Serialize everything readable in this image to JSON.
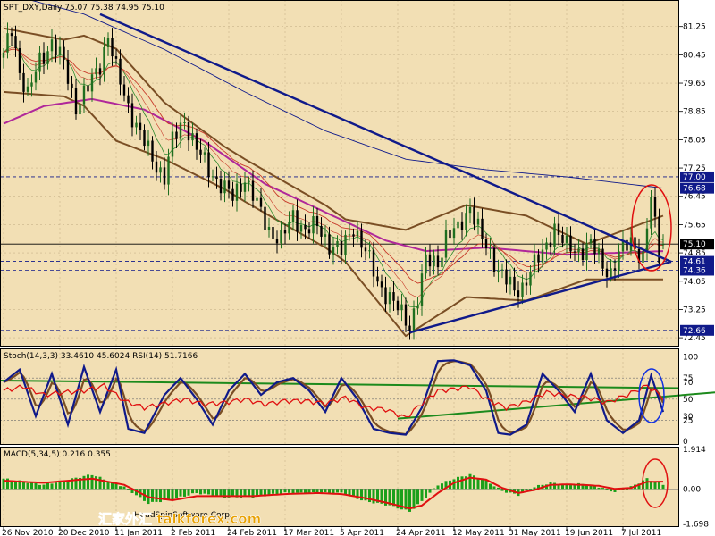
{
  "colors": {
    "panel_bg": "#f2dfb4",
    "frame": "#000000",
    "grid": "#c8b48a",
    "bull": "#1f6e1f",
    "bear": "#000000",
    "bollinger": "#7a4e24",
    "ma_pink": "#b0279a",
    "ma_red": "#c83a2a",
    "ma_green": "#2e8b2e",
    "navy": "#101a8a",
    "stoch_main": "#101a8a",
    "stoch_signal": "#7a4e24",
    "rsi": "#e01010",
    "trend_green": "#1c8a1c",
    "macd_hist": "#1aa01a",
    "macd_signal": "#e01010",
    "circle_red": "#e01010",
    "circle_blue": "#1030e0",
    "level_box": "#101a8a",
    "level_box_price": "#000000"
  },
  "header": {
    "main": "SPT_DXY,Daily  75.07 75.38 74.95 75.10",
    "stoch": "Stoch(14,3,3) 33.4610 45.6024  RSI(14) 51.7166",
    "macd": "MACD(5,34,5) 0.216 0.355",
    "copyright": "HeadSpinSoftware Corp.",
    "watermark": "汇家外汇 talkforex.com"
  },
  "price_axis": {
    "ticks": [
      "81.25",
      "80.45",
      "79.65",
      "78.85",
      "78.05",
      "77.25",
      "76.45",
      "75.65",
      "74.85",
      "74.05",
      "73.25",
      "72.45"
    ],
    "boxes": [
      {
        "label": "77.00",
        "price": 77.0,
        "style": "level"
      },
      {
        "label": "76.68",
        "price": 76.68,
        "style": "level"
      },
      {
        "label": "75.10",
        "price": 75.1,
        "style": "price"
      },
      {
        "label": "74.61",
        "price": 74.61,
        "style": "level"
      },
      {
        "label": "74.36",
        "price": 74.36,
        "style": "level"
      },
      {
        "label": "72.66",
        "price": 72.66,
        "style": "level"
      }
    ]
  },
  "stoch_axis": {
    "ticks": [
      "100",
      "75",
      "70",
      "50",
      "30",
      "25",
      "0"
    ]
  },
  "macd_axis": {
    "ticks": [
      "1.914",
      "0.00",
      "-1.698"
    ]
  },
  "x_axis": {
    "labels": [
      "26 Nov 2010",
      "20 Dec 2010",
      "11 Jan 2011",
      "2 Feb 2011",
      "24 Feb 2011",
      "17 Mar 2011",
      "5 Apr 2011",
      "24 Apr 2011",
      "12 May 2011",
      "31 May 2011",
      "19 Jun 2011",
      "7 Jul 2011"
    ]
  },
  "chart_data": {
    "type": "candlestick",
    "title": "SPT_DXY,Daily",
    "ohlc_last": {
      "open": 75.07,
      "high": 75.38,
      "low": 74.95,
      "close": 75.1
    },
    "price_range": [
      72.2,
      82.0
    ],
    "close_keypoints": [
      [
        0,
        80.4
      ],
      [
        2,
        81.2
      ],
      [
        4,
        80.0
      ],
      [
        6,
        79.3
      ],
      [
        9,
        80.3
      ],
      [
        12,
        80.8
      ],
      [
        15,
        80.2
      ],
      [
        18,
        79.0
      ],
      [
        21,
        79.5
      ],
      [
        24,
        80.2
      ],
      [
        26,
        81.0
      ],
      [
        28,
        80.0
      ],
      [
        31,
        79.0
      ],
      [
        34,
        78.2
      ],
      [
        37,
        77.5
      ],
      [
        40,
        77.0
      ],
      [
        42,
        78.0
      ],
      [
        45,
        78.6
      ],
      [
        48,
        77.8
      ],
      [
        51,
        77.2
      ],
      [
        54,
        76.8
      ],
      [
        57,
        76.4
      ],
      [
        60,
        77.0
      ],
      [
        63,
        76.2
      ],
      [
        66,
        75.5
      ],
      [
        69,
        75.2
      ],
      [
        72,
        75.9
      ],
      [
        75,
        75.5
      ],
      [
        78,
        75.6
      ],
      [
        81,
        75.1
      ],
      [
        84,
        74.9
      ],
      [
        87,
        75.6
      ],
      [
        90,
        74.9
      ],
      [
        93,
        74.0
      ],
      [
        96,
        73.6
      ],
      [
        99,
        73.1
      ],
      [
        101,
        72.8
      ],
      [
        103,
        73.6
      ],
      [
        105,
        74.6
      ],
      [
        108,
        74.6
      ],
      [
        110,
        75.3
      ],
      [
        113,
        75.5
      ],
      [
        116,
        76.2
      ],
      [
        119,
        75.2
      ],
      [
        122,
        74.6
      ],
      [
        125,
        74.1
      ],
      [
        127,
        73.7
      ],
      [
        129,
        73.9
      ],
      [
        131,
        74.4
      ],
      [
        134,
        74.8
      ],
      [
        137,
        75.6
      ],
      [
        140,
        75.0
      ],
      [
        143,
        74.9
      ],
      [
        146,
        75.1
      ],
      [
        149,
        74.5
      ],
      [
        151,
        74.3
      ],
      [
        153,
        74.8
      ],
      [
        156,
        75.2
      ],
      [
        159,
        74.7
      ],
      [
        161,
        76.4
      ],
      [
        163,
        74.8
      ],
      [
        164,
        75.1
      ]
    ],
    "bollinger_mid_keypoints": [
      [
        0,
        80.3
      ],
      [
        20,
        80.0
      ],
      [
        40,
        78.3
      ],
      [
        60,
        76.9
      ],
      [
        80,
        75.6
      ],
      [
        100,
        74.0
      ],
      [
        115,
        74.9
      ],
      [
        130,
        74.7
      ],
      [
        145,
        74.6
      ],
      [
        164,
        75.0
      ]
    ],
    "bollinger_width_keypoints": [
      [
        0,
        0.9
      ],
      [
        15,
        0.8
      ],
      [
        28,
        1.3
      ],
      [
        40,
        0.8
      ],
      [
        55,
        0.6
      ],
      [
        70,
        0.6
      ],
      [
        85,
        0.6
      ],
      [
        100,
        1.5
      ],
      [
        115,
        1.3
      ],
      [
        130,
        1.2
      ],
      [
        145,
        0.5
      ],
      [
        164,
        0.9
      ]
    ],
    "ma_pink_keypoints": [
      [
        0,
        78.5
      ],
      [
        10,
        79.0
      ],
      [
        22,
        79.2
      ],
      [
        35,
        78.9
      ],
      [
        50,
        78.0
      ],
      [
        65,
        76.8
      ],
      [
        80,
        76.0
      ],
      [
        95,
        75.2
      ],
      [
        105,
        74.9
      ],
      [
        120,
        75.0
      ],
      [
        140,
        74.8
      ],
      [
        164,
        74.9
      ]
    ],
    "ma_navy_keypoints": [
      [
        0,
        82.2
      ],
      [
        20,
        81.6
      ],
      [
        40,
        80.6
      ],
      [
        60,
        79.4
      ],
      [
        80,
        78.3
      ],
      [
        100,
        77.5
      ],
      [
        120,
        77.2
      ],
      [
        140,
        77.0
      ],
      [
        164,
        76.68
      ]
    ],
    "trendlines": [
      {
        "name": "resistance",
        "from": [
          24,
          81.6
        ],
        "to": [
          166,
          74.6
        ]
      },
      {
        "name": "support",
        "from": [
          101,
          72.6
        ],
        "to": [
          166,
          74.6
        ]
      }
    ],
    "horizontal_levels": [
      77.0,
      76.68,
      75.1,
      74.61,
      74.36,
      72.66
    ],
    "stoch": {
      "k_keypoints": [
        [
          0,
          70
        ],
        [
          4,
          85
        ],
        [
          8,
          30
        ],
        [
          12,
          80
        ],
        [
          16,
          20
        ],
        [
          20,
          88
        ],
        [
          24,
          35
        ],
        [
          28,
          85
        ],
        [
          31,
          15
        ],
        [
          35,
          10
        ],
        [
          40,
          55
        ],
        [
          44,
          75
        ],
        [
          48,
          50
        ],
        [
          52,
          20
        ],
        [
          56,
          60
        ],
        [
          60,
          80
        ],
        [
          64,
          55
        ],
        [
          68,
          70
        ],
        [
          72,
          75
        ],
        [
          76,
          60
        ],
        [
          80,
          35
        ],
        [
          84,
          75
        ],
        [
          88,
          50
        ],
        [
          92,
          15
        ],
        [
          96,
          10
        ],
        [
          100,
          8
        ],
        [
          104,
          40
        ],
        [
          108,
          95
        ],
        [
          112,
          96
        ],
        [
          116,
          90
        ],
        [
          120,
          60
        ],
        [
          123,
          10
        ],
        [
          126,
          8
        ],
        [
          130,
          20
        ],
        [
          134,
          80
        ],
        [
          138,
          60
        ],
        [
          142,
          35
        ],
        [
          146,
          80
        ],
        [
          150,
          25
        ],
        [
          154,
          10
        ],
        [
          158,
          25
        ],
        [
          161,
          78
        ],
        [
          164,
          35
        ]
      ],
      "rsi_keypoints": [
        [
          0,
          60
        ],
        [
          5,
          65
        ],
        [
          10,
          55
        ],
        [
          15,
          58
        ],
        [
          20,
          60
        ],
        [
          25,
          66
        ],
        [
          30,
          48
        ],
        [
          35,
          40
        ],
        [
          40,
          45
        ],
        [
          45,
          50
        ],
        [
          50,
          44
        ],
        [
          55,
          46
        ],
        [
          60,
          50
        ],
        [
          65,
          44
        ],
        [
          70,
          48
        ],
        [
          75,
          48
        ],
        [
          80,
          45
        ],
        [
          85,
          52
        ],
        [
          90,
          40
        ],
        [
          95,
          38
        ],
        [
          100,
          28
        ],
        [
          104,
          45
        ],
        [
          108,
          60
        ],
        [
          112,
          62
        ],
        [
          116,
          65
        ],
        [
          120,
          50
        ],
        [
          125,
          40
        ],
        [
          130,
          47
        ],
        [
          135,
          58
        ],
        [
          140,
          54
        ],
        [
          145,
          52
        ],
        [
          150,
          46
        ],
        [
          155,
          55
        ],
        [
          160,
          66
        ],
        [
          164,
          52
        ]
      ],
      "levels": [
        25,
        50,
        75
      ]
    },
    "macd": {
      "hist_keypoints": [
        [
          0,
          0.5
        ],
        [
          10,
          0.2
        ],
        [
          22,
          0.7
        ],
        [
          30,
          0.1
        ],
        [
          36,
          -0.7
        ],
        [
          42,
          -0.5
        ],
        [
          48,
          -0.2
        ],
        [
          55,
          -0.4
        ],
        [
          62,
          -0.4
        ],
        [
          70,
          -0.2
        ],
        [
          78,
          -0.2
        ],
        [
          84,
          -0.2
        ],
        [
          90,
          -0.6
        ],
        [
          96,
          -0.8
        ],
        [
          101,
          -1.1
        ],
        [
          104,
          -0.6
        ],
        [
          108,
          0.2
        ],
        [
          112,
          0.5
        ],
        [
          116,
          0.7
        ],
        [
          120,
          0.4
        ],
        [
          124,
          -0.1
        ],
        [
          128,
          -0.3
        ],
        [
          132,
          0.1
        ],
        [
          136,
          0.3
        ],
        [
          140,
          0.2
        ],
        [
          144,
          0.25
        ],
        [
          148,
          0.1
        ],
        [
          152,
          -0.15
        ],
        [
          156,
          0.1
        ],
        [
          160,
          0.5
        ],
        [
          164,
          0.216
        ]
      ],
      "signal_keypoints": [
        [
          0,
          0.4
        ],
        [
          10,
          0.3
        ],
        [
          22,
          0.5
        ],
        [
          30,
          0.2
        ],
        [
          36,
          -0.4
        ],
        [
          42,
          -0.55
        ],
        [
          48,
          -0.35
        ],
        [
          55,
          -0.35
        ],
        [
          62,
          -0.35
        ],
        [
          70,
          -0.25
        ],
        [
          78,
          -0.2
        ],
        [
          84,
          -0.25
        ],
        [
          90,
          -0.45
        ],
        [
          96,
          -0.7
        ],
        [
          101,
          -0.95
        ],
        [
          104,
          -0.8
        ],
        [
          108,
          -0.2
        ],
        [
          112,
          0.3
        ],
        [
          116,
          0.55
        ],
        [
          120,
          0.45
        ],
        [
          124,
          0.05
        ],
        [
          128,
          -0.2
        ],
        [
          132,
          -0.05
        ],
        [
          136,
          0.2
        ],
        [
          140,
          0.22
        ],
        [
          144,
          0.2
        ],
        [
          148,
          0.15
        ],
        [
          152,
          0.0
        ],
        [
          156,
          0.05
        ],
        [
          160,
          0.35
        ],
        [
          164,
          0.355
        ]
      ],
      "range": [
        -1.698,
        1.914
      ]
    }
  }
}
